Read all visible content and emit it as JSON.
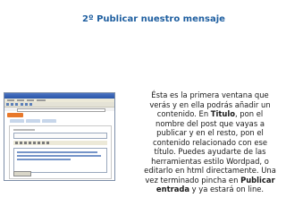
{
  "slide": {
    "title": "2º Publicar nuestro mensaje",
    "description": {
      "p1": "Ésta es la primera ventana que verás y en ella podrás añadir un contenido. En ",
      "b1": "Titulo",
      "p2": ", pon el nombre del post que vayas a publicar y en el resto, pon el contenido relacionado con ese título. Puedes ayudarte de las herramientas estilo Wordpad, o editarlo en html directamente. Una vez terminado pincha en ",
      "b2": "Publicar entrada",
      "p3": " y ya estará on line."
    }
  },
  "colors": {
    "title": "#1f5fa0",
    "browser_title_bar": "#2a56a8",
    "app_logo": "#e8782a"
  }
}
